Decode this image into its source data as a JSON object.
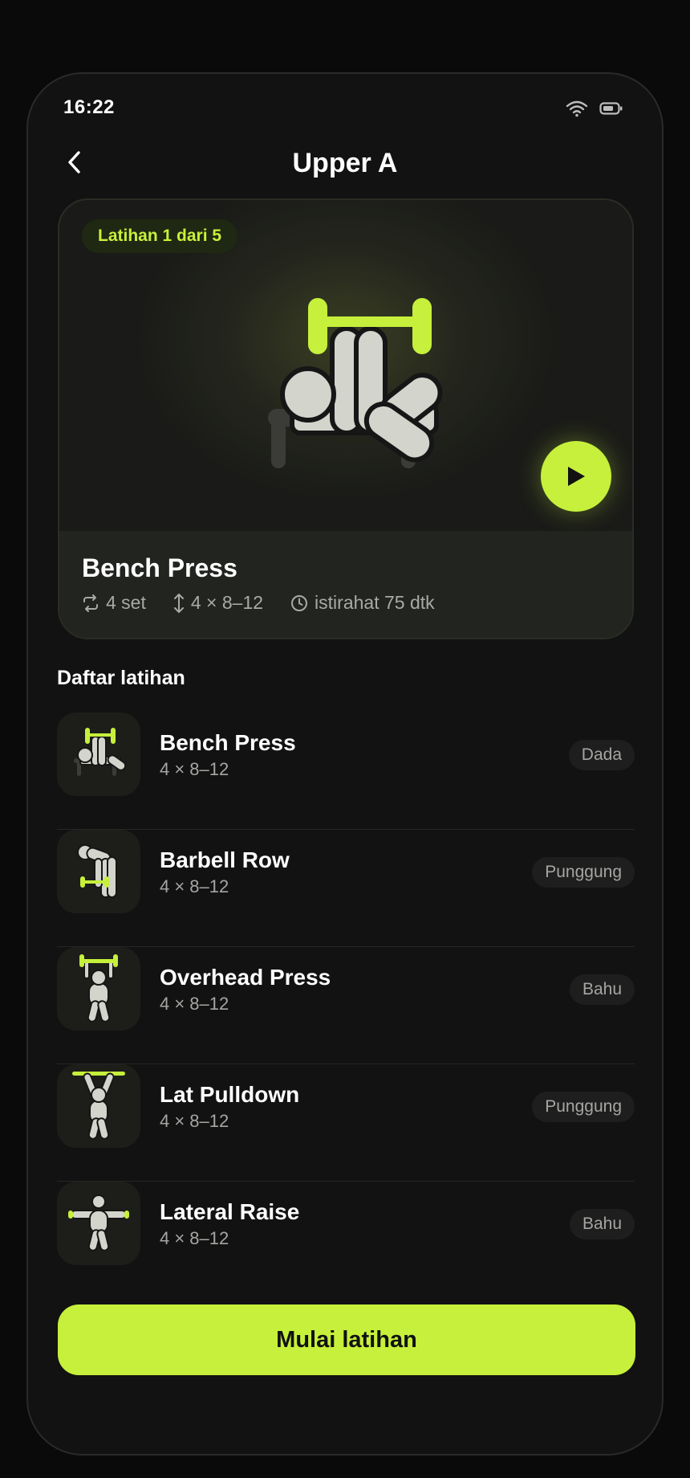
{
  "status_bar": {
    "time": "16:22",
    "wifi_icon": "wifi-icon",
    "battery_icon": "battery-icon"
  },
  "header": {
    "title": "Upper A",
    "back_icon": "chevron-left-icon"
  },
  "hero": {
    "badge": "Latihan 1 dari 5",
    "name": "Bench Press",
    "sets": "4 set",
    "reps": "4 × 8–12",
    "rest": "istirahat 75 dtk",
    "play_icon": "play-icon"
  },
  "section_title": "Daftar latihan",
  "exercises": [
    {
      "name": "Bench Press",
      "sets": "4 × 8–12",
      "tag": "Dada",
      "icon": "bench-press-icon"
    },
    {
      "name": "Barbell Row",
      "sets": "4 × 8–12",
      "tag": "Punggung",
      "icon": "barbell-row-icon"
    },
    {
      "name": "Overhead Press",
      "sets": "4 × 8–12",
      "tag": "Bahu",
      "icon": "overhead-press-icon"
    },
    {
      "name": "Lat Pulldown",
      "sets": "4 × 8–12",
      "tag": "Punggung",
      "icon": "lat-pulldown-icon"
    },
    {
      "name": "Lateral Raise",
      "sets": "4 × 8–12",
      "tag": "Bahu",
      "icon": "lateral-raise-icon"
    }
  ],
  "cta": {
    "label": "Mulai latihan"
  },
  "colors": {
    "accent": "#c6f03b",
    "background": "#121212",
    "figure": "#cfcfc8"
  }
}
